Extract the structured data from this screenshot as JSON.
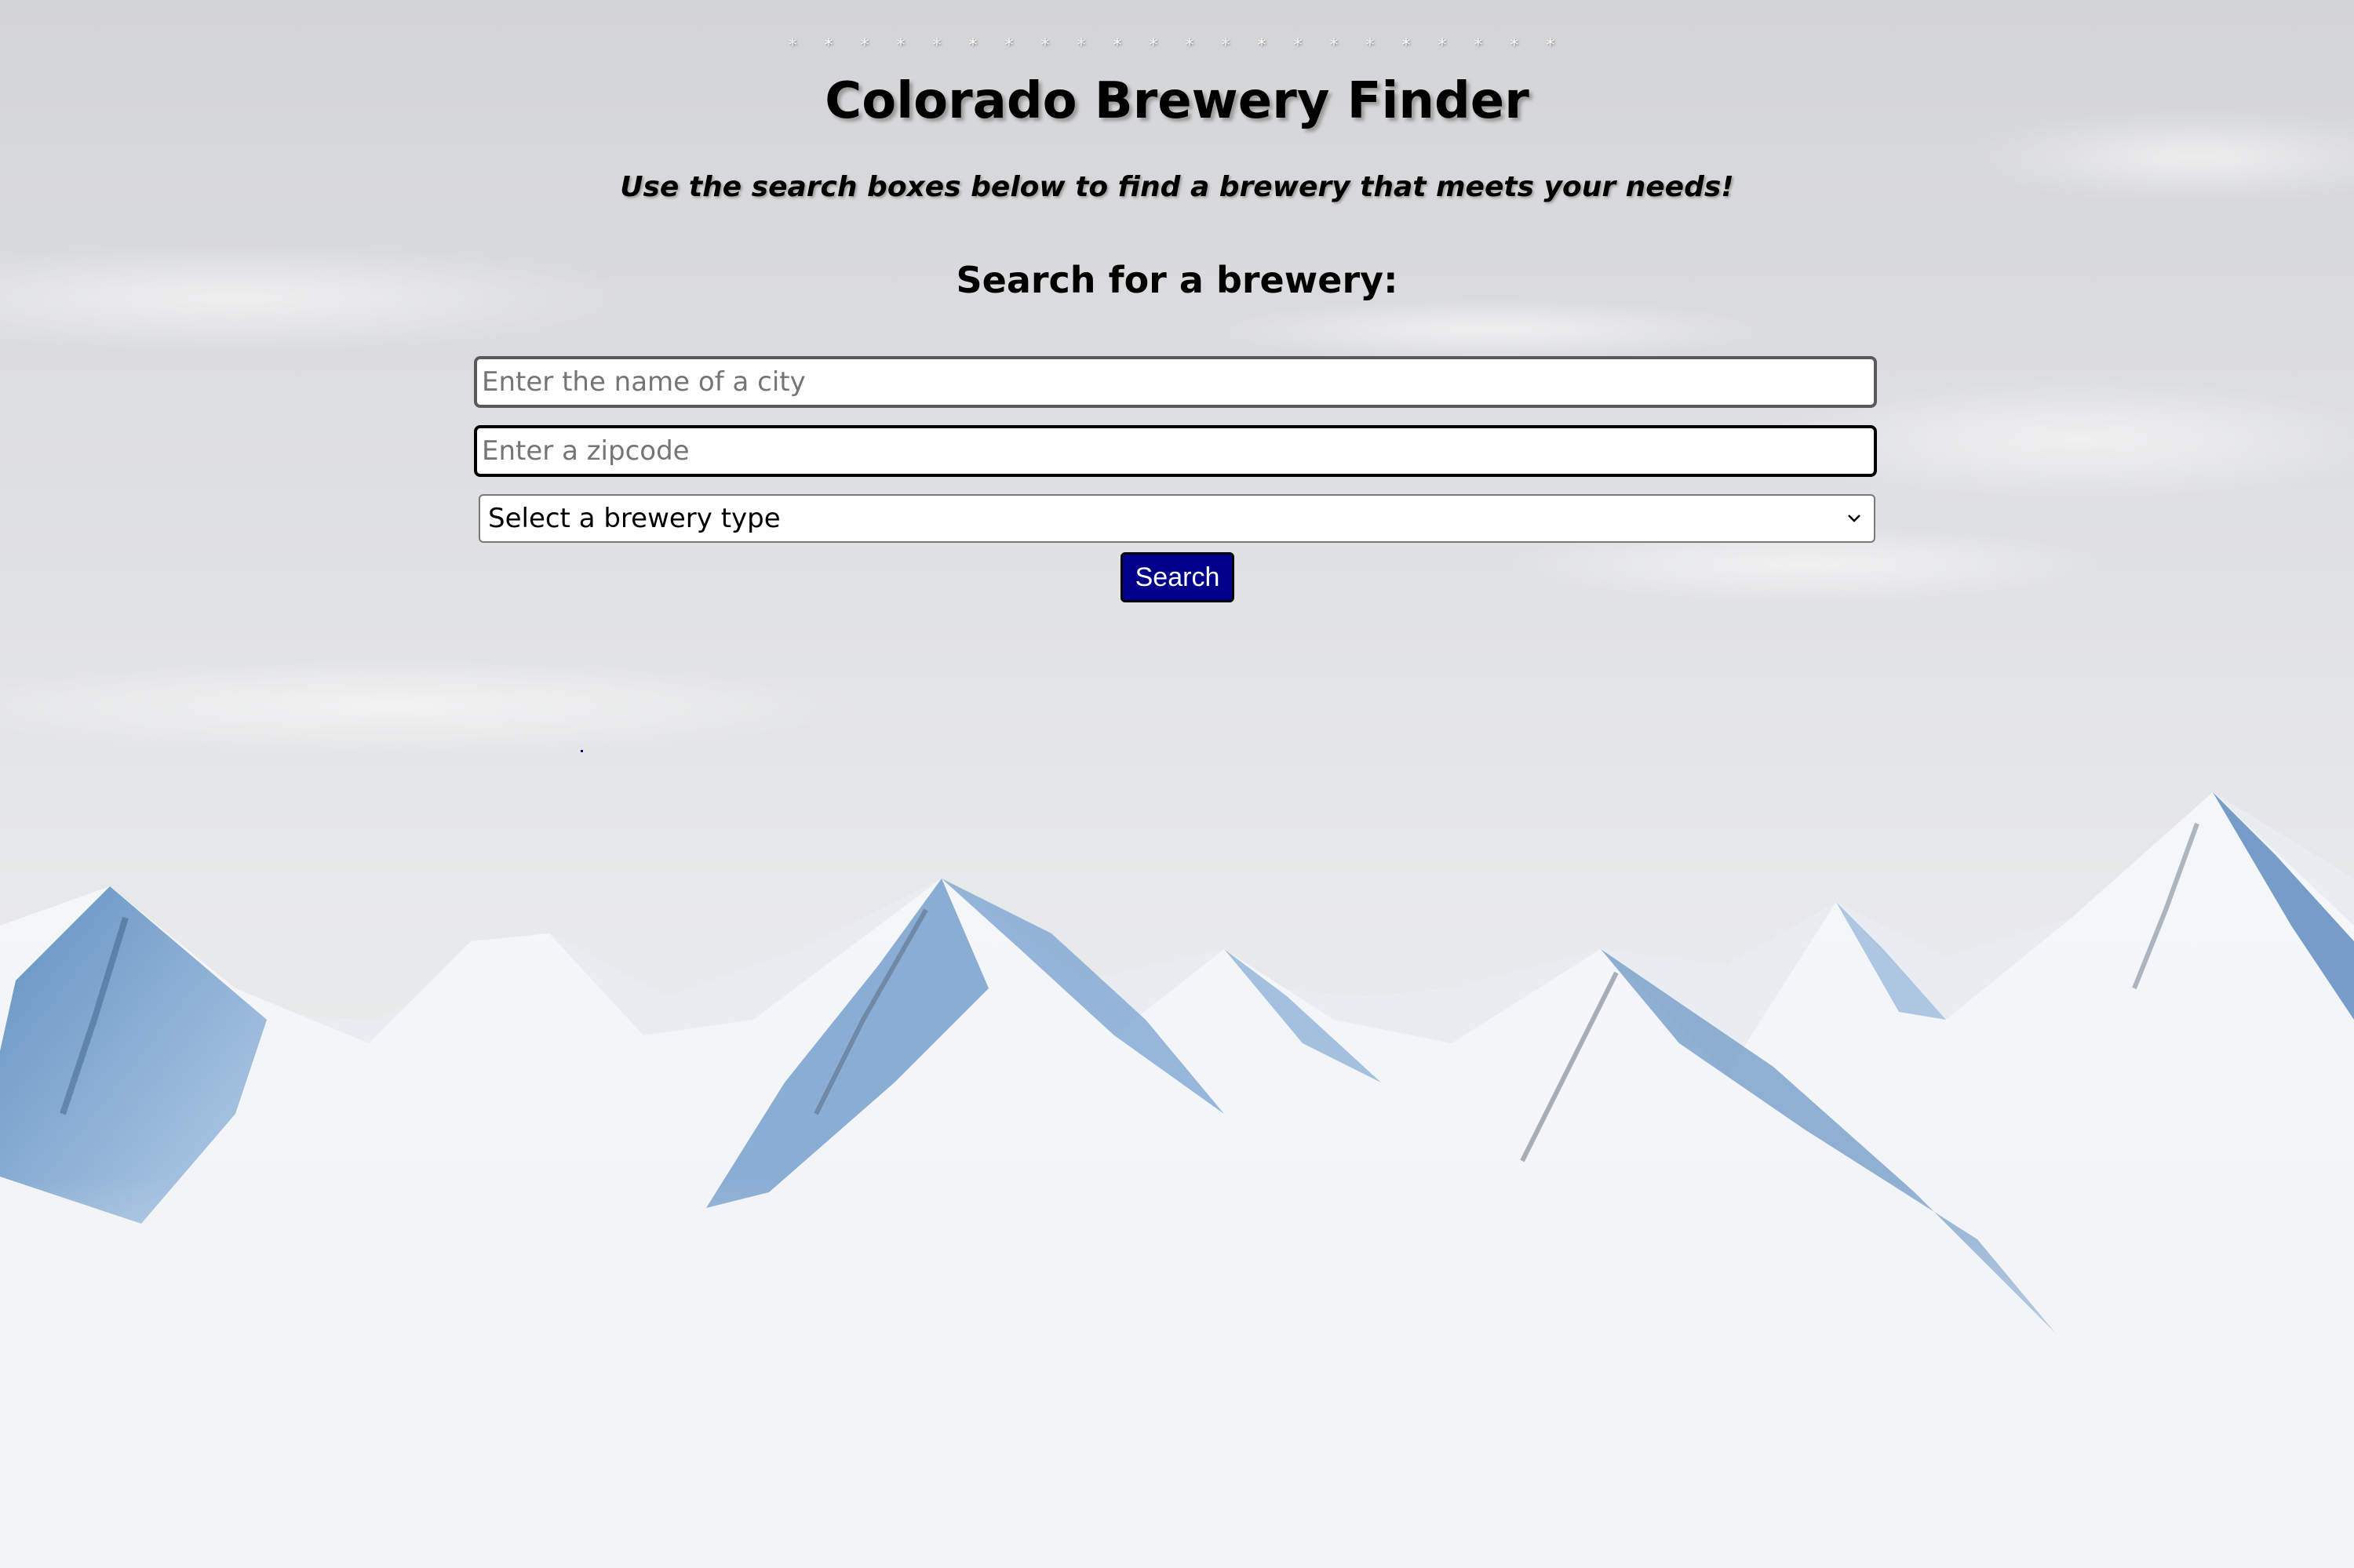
{
  "header": {
    "ornament": "* * * * * * * * *   * * * * * * *   * * * * * *",
    "title": "Colorado Brewery Finder",
    "subtitle": "Use the search boxes below to find a brewery that meets your needs!"
  },
  "search": {
    "heading": "Search for a brewery:",
    "city_placeholder": "Enter the name of a city",
    "zip_placeholder": "Enter a zipcode",
    "type_selected": "Select a brewery type",
    "button_label": "Search"
  },
  "colors": {
    "button_bg": "#00008b",
    "button_text": "#ffffff",
    "title_text": "#000000"
  },
  "background": {
    "scene": "snowy-mountains-image"
  }
}
